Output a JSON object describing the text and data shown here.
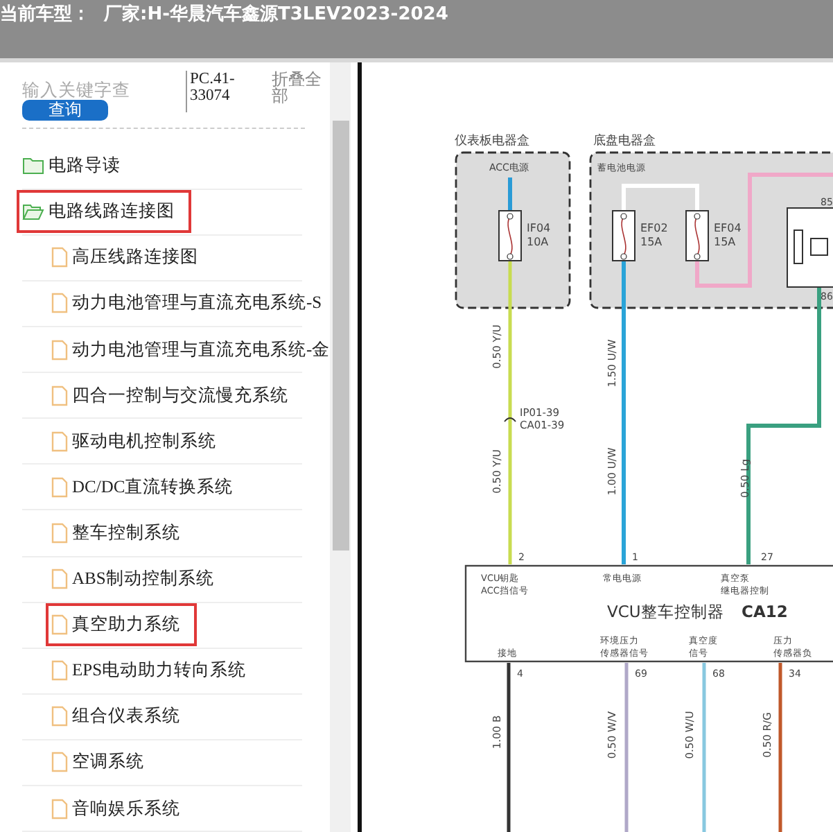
{
  "header": {
    "label": "当前车型：",
    "value": "厂家:H-华晨汽车鑫源T3LEV2023-2024"
  },
  "search": {
    "placeholder": "输入关键字查",
    "button": "查询",
    "code": "PC.41-33074",
    "collapse": "折叠全部"
  },
  "tree": [
    {
      "label": "电路导读",
      "kind": "folder",
      "expanded": false,
      "highlighted": false
    },
    {
      "label": "电路线路连接图",
      "kind": "folder",
      "expanded": true,
      "highlighted": true,
      "children": [
        {
          "label": "高压线路连接图",
          "kind": "file",
          "highlighted": false
        },
        {
          "label": "动力电池管理与直流充电系统-S",
          "kind": "file",
          "highlighted": false
        },
        {
          "label": "动力电池管理与直流充电系统-金",
          "kind": "file",
          "highlighted": false
        },
        {
          "label": "四合一控制与交流慢充系统",
          "kind": "file",
          "highlighted": false
        },
        {
          "label": "驱动电机控制系统",
          "kind": "file",
          "highlighted": false
        },
        {
          "label": "DC/DC直流转换系统",
          "kind": "file",
          "highlighted": false
        },
        {
          "label": "整车控制系统",
          "kind": "file",
          "highlighted": false
        },
        {
          "label": "ABS制动控制系统",
          "kind": "file",
          "highlighted": false
        },
        {
          "label": "真空助力系统",
          "kind": "file",
          "highlighted": true
        },
        {
          "label": "EPS电动助力转向系统",
          "kind": "file",
          "highlighted": false
        },
        {
          "label": "组合仪表系统",
          "kind": "file",
          "highlighted": false
        },
        {
          "label": "空调系统",
          "kind": "file",
          "highlighted": false
        },
        {
          "label": "音响娱乐系统",
          "kind": "file",
          "highlighted": false
        }
      ]
    }
  ],
  "diagram": {
    "boxes": [
      {
        "title": "仪表板电器盒",
        "source": "ACC电源"
      },
      {
        "title": "底盘电器盒",
        "source": "蓄电池电源"
      }
    ],
    "fuses": [
      {
        "name": "IF04",
        "rating": "10A"
      },
      {
        "name": "EF02",
        "rating": "15A"
      },
      {
        "name": "EF04",
        "rating": "15A"
      }
    ],
    "relay_pins": [
      "85",
      "86"
    ],
    "connector": [
      "IP01-39",
      "CA01-39"
    ],
    "wire_labels": [
      "0.50 Y/U",
      "1.50 U/W",
      "0.50 Y/U",
      "1.00 U/W",
      "0.50 Lg",
      "1.00 B",
      "0.50 W/V",
      "0.50 W/U",
      "0.50 R/G"
    ],
    "controller": {
      "title": "VCU整车控制器",
      "code": "CA12",
      "top_pins": [
        {
          "pin": "2",
          "lines": [
            "VCU钥匙",
            "ACC挡信号"
          ]
        },
        {
          "pin": "1",
          "lines": [
            "常电电源"
          ]
        },
        {
          "pin": "27",
          "lines": [
            "真空泵",
            "继电器控制"
          ]
        }
      ],
      "bottom_pins": [
        {
          "pin": "4",
          "lines": [
            "接地"
          ]
        },
        {
          "pin": "69",
          "lines": [
            "环境压力",
            "传感器信号"
          ]
        },
        {
          "pin": "68",
          "lines": [
            "真空度",
            "信号"
          ]
        },
        {
          "pin": "34",
          "lines": [
            "压力",
            "传感器负"
          ]
        }
      ]
    }
  }
}
